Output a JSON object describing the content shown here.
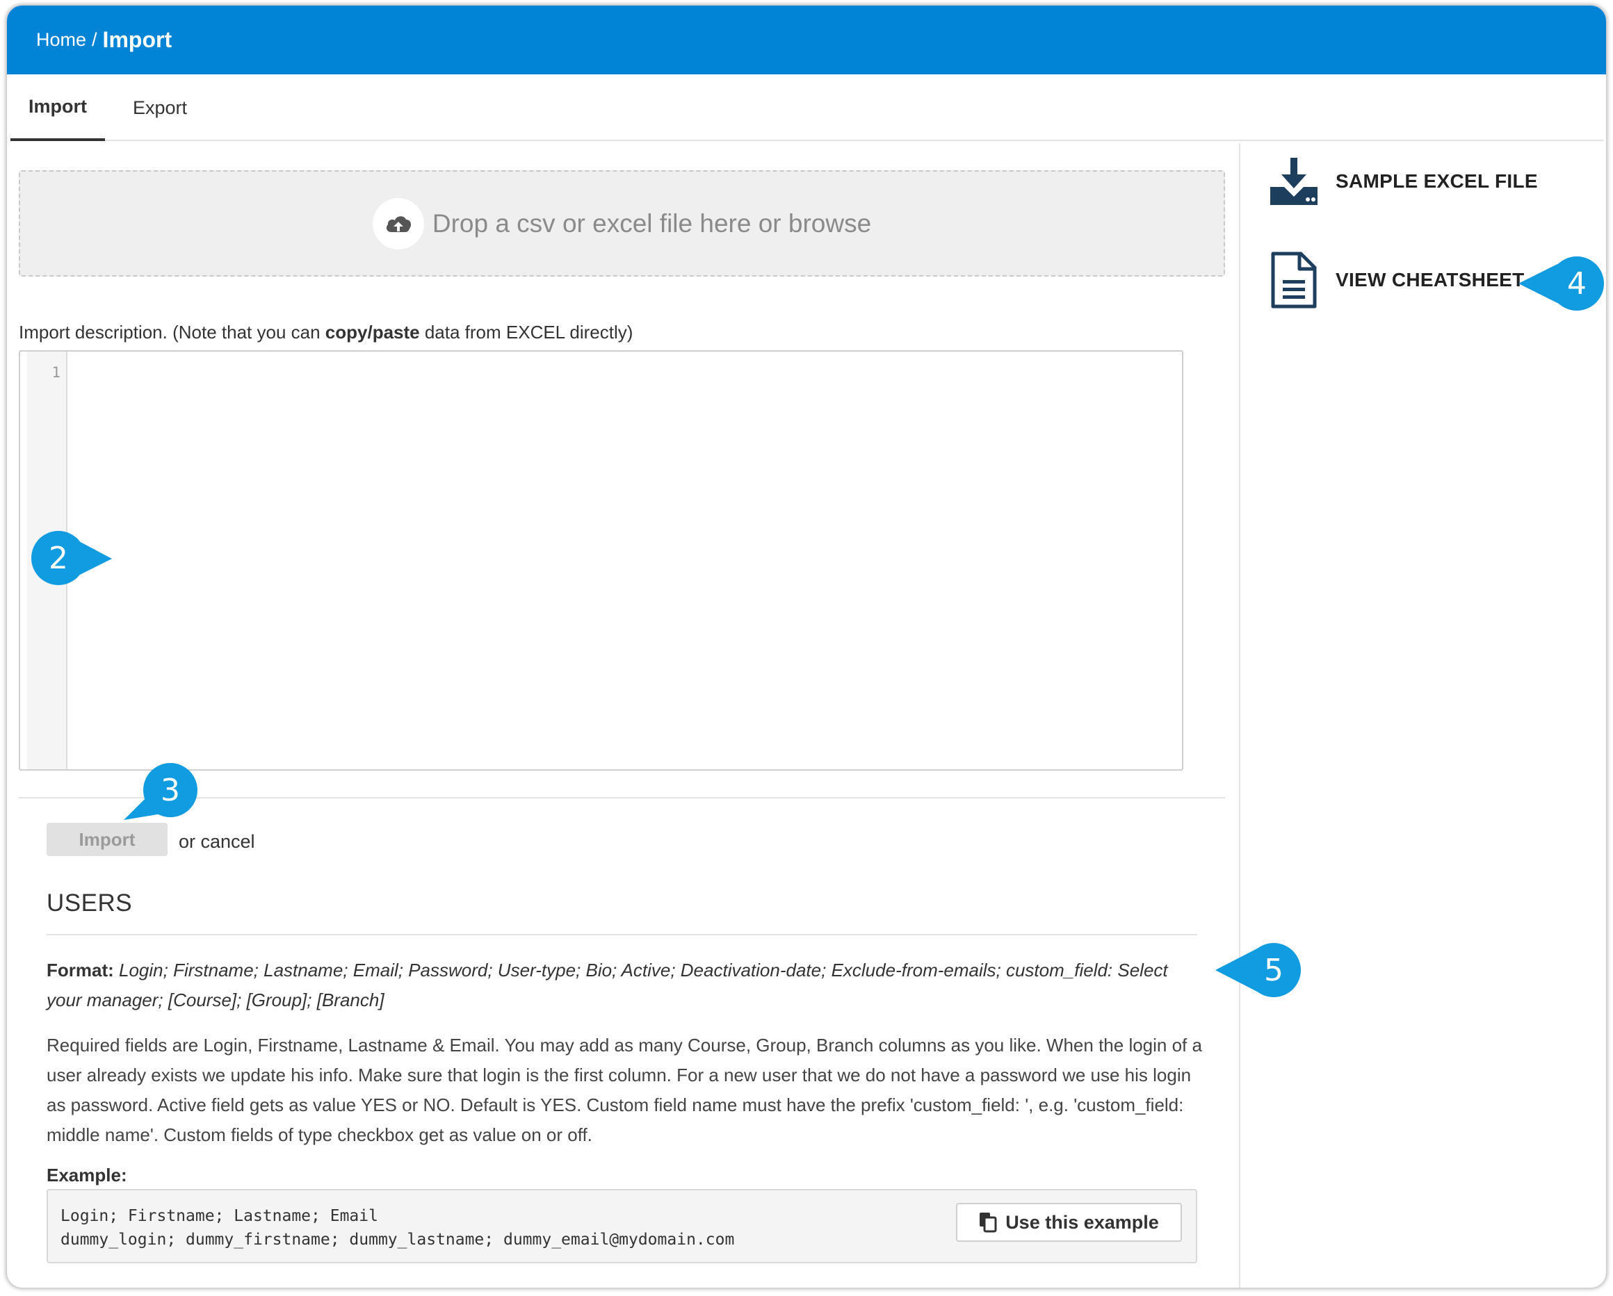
{
  "header": {
    "breadcrumb_home": "Home",
    "breadcrumb_sep": "/",
    "breadcrumb_current": "Import"
  },
  "tabs": [
    {
      "label": "Import",
      "active": true
    },
    {
      "label": "Export",
      "active": false
    }
  ],
  "dropzone": {
    "text": "Drop a csv or excel file here or browse",
    "icon": "cloud-upload-icon"
  },
  "description": {
    "prefix": "Import description. (Note that you can ",
    "bold": "copy/paste",
    "suffix": " data from EXCEL directly)"
  },
  "editor": {
    "line_number": "1",
    "content": ""
  },
  "actions": {
    "import_label": "Import",
    "cancel_text": "or cancel"
  },
  "users": {
    "title": "USERS",
    "format_label": "Format:",
    "format_value": "Login; Firstname; Lastname; Email; Password; User-type; Bio; Active; Deactivation-date; Exclude-from-emails; custom_field: Select your manager; [Course]; [Group]; [Branch]",
    "required_text": "Required fields are Login, Firstname, Lastname & Email. You may add as many Course, Group, Branch columns as you like. When the login of a user already exists we update his info. Make sure that login is the first column. For a new user that we do not have a password we use his login as password. Active field gets as value YES or NO. Default is YES. Custom field name must have the prefix 'custom_field: ', e.g. 'custom_field: middle name'. Custom fields of type checkbox get as value on or off.",
    "example_label": "Example:",
    "example_line1": "Login; Firstname; Lastname; Email",
    "example_line2": "dummy_login; dummy_firstname; dummy_lastname; dummy_email@mydomain.com",
    "use_example_label": "Use this example"
  },
  "sidebar": {
    "sample_label": "SAMPLE EXCEL FILE",
    "cheatsheet_label": "VIEW CHEATSHEET"
  },
  "callouts": [
    "2",
    "3",
    "4",
    "5"
  ],
  "colors": {
    "accent": "#0284d6",
    "callout": "#119be0"
  }
}
